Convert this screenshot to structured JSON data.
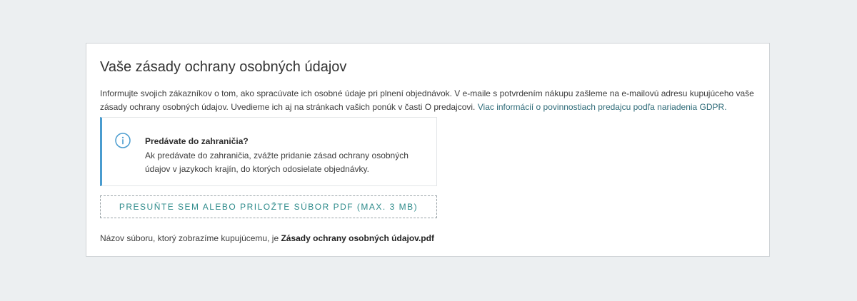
{
  "card": {
    "title": "Vaše zásady ochrany osobných údajov",
    "description_text": "Informujte svojich zákazníkov o tom, ako spracúvate ich osobné údaje pri plnení objednávok. V e-maile s potvrdením nákupu zašleme na e-mailovú adresu kupujúceho vaše zásady ochrany osobných údajov. Uvedieme ich aj na stránkach vašich ponúk v časti O predajcovi. ",
    "description_link": "Viac informácií o povinnostiach predajcu podľa nariadenia GDPR."
  },
  "notice": {
    "icon": "info-icon",
    "title": "Predávate do zahraničia?",
    "body": "Ak predávate do zahraničia, zvážte pridanie zásad ochrany osobných údajov v jazykoch krajín, do ktorých odosielate objednávky."
  },
  "dropzone": {
    "label": "PRESUŇTE SEM ALEBO PRILOŽTE SÚBOR PDF (MAX. 3 MB)"
  },
  "file": {
    "prefix": "Názov súboru, ktorý zobrazíme kupujúcemu, je ",
    "name": "Zásady ochrany osobných údajov.pdf"
  },
  "colors": {
    "background": "#eceff1",
    "accent_info": "#4a9ccf",
    "link": "#2e6b78",
    "dropzone_text": "#2e8b8b"
  }
}
